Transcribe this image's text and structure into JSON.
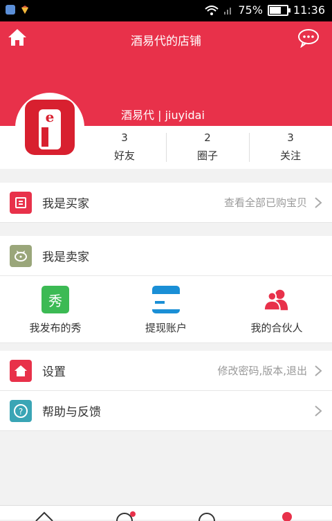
{
  "status_bar": {
    "battery": "75%",
    "time": "11:36",
    "battery_level": 0.75
  },
  "header": {
    "title": "酒易代的店铺",
    "user_name": "酒易代 | jiuyidai"
  },
  "stats": [
    {
      "count": "3",
      "label": "好友"
    },
    {
      "count": "2",
      "label": "圈子"
    },
    {
      "count": "3",
      "label": "关注"
    }
  ],
  "buyer": {
    "label": "我是买家",
    "hint": "查看全部已购宝贝"
  },
  "seller": {
    "label": "我是卖家",
    "items": [
      {
        "label": "我发布的秀",
        "icon_text": "秀"
      },
      {
        "label": "提现账户"
      },
      {
        "label": "我的合伙人"
      }
    ]
  },
  "settings": {
    "label": "设置",
    "hint": "修改密码,版本,退出"
  },
  "help": {
    "label": "帮助与反馈"
  },
  "colors": {
    "brand_red": "#e8314a",
    "seller_green": "#9aa67a",
    "show_green": "#3cba54",
    "wallet_blue": "#1a8fd6",
    "help_teal": "#3aa5b5"
  },
  "icons": [
    "home-icon",
    "chat-bubble-icon",
    "receipt-icon",
    "piggy-bank-icon",
    "wallet-icon",
    "partners-icon",
    "help-icon",
    "chevron-right-icon"
  ]
}
